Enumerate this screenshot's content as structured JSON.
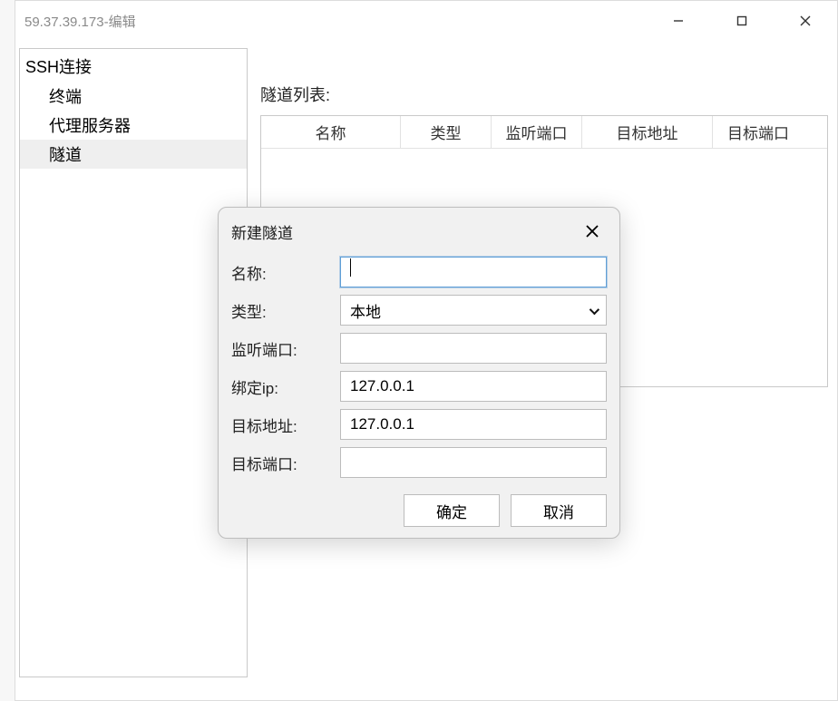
{
  "window": {
    "title": "59.37.39.173-编辑"
  },
  "sidebar": {
    "root": "SSH连接",
    "items": [
      {
        "label": "终端"
      },
      {
        "label": "代理服务器"
      },
      {
        "label": "隧道",
        "selected": true
      }
    ]
  },
  "content": {
    "list_label": "隧道列表:",
    "columns": {
      "name": "名称",
      "type": "类型",
      "listen_port": "监听端口",
      "target_addr": "目标地址",
      "target_port": "目标端口"
    }
  },
  "modal": {
    "title": "新建隧道",
    "labels": {
      "name": "名称:",
      "type": "类型:",
      "listen_port": "监听端口:",
      "bind_ip": "绑定ip:",
      "target_addr": "目标地址:",
      "target_port": "目标端口:"
    },
    "values": {
      "name": "",
      "type": "本地",
      "listen_port": "",
      "bind_ip": "127.0.0.1",
      "target_addr": "127.0.0.1",
      "target_port": ""
    },
    "buttons": {
      "ok": "确定",
      "cancel": "取消"
    }
  }
}
